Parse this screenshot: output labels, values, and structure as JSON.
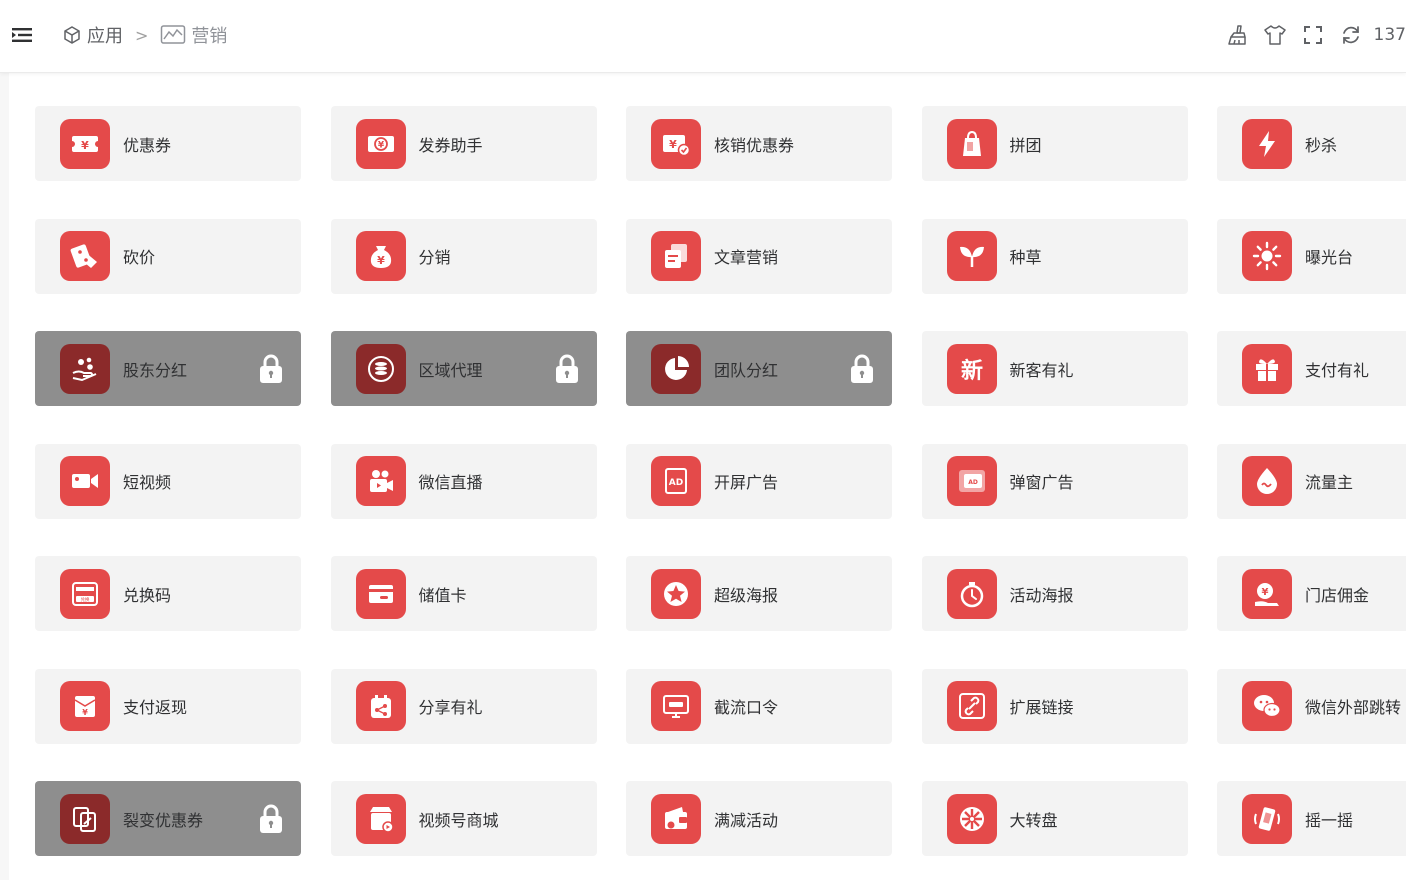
{
  "header": {
    "breadcrumb": [
      {
        "label": "应用",
        "icon": "cube-icon"
      },
      {
        "label": "营销",
        "icon": "marketing-chart-icon"
      }
    ],
    "separator": ">",
    "actions": [
      "broom-icon",
      "tshirt-icon",
      "fullscreen-icon",
      "refresh-icon"
    ],
    "user_id": "137"
  },
  "colors": {
    "accent": "#e44a4a",
    "card_bg": "#f3f3f3",
    "locked_card_bg": "#8e8e8e",
    "locked_icon_bg": "#8b2a2a"
  },
  "apps": [
    {
      "label": "优惠券",
      "icon": "coupon-icon",
      "locked": false
    },
    {
      "label": "发券助手",
      "icon": "coupon-send-icon",
      "locked": false
    },
    {
      "label": "核销优惠券",
      "icon": "coupon-verify-icon",
      "locked": false
    },
    {
      "label": "拼团",
      "icon": "group-buy-icon",
      "locked": false
    },
    {
      "label": "秒杀",
      "icon": "flash-sale-icon",
      "locked": false
    },
    {
      "label": "砍价",
      "icon": "bargain-icon",
      "locked": false
    },
    {
      "label": "分销",
      "icon": "distribution-icon",
      "locked": false
    },
    {
      "label": "文章营销",
      "icon": "article-icon",
      "locked": false
    },
    {
      "label": "种草",
      "icon": "sprout-icon",
      "locked": false
    },
    {
      "label": "曝光台",
      "icon": "sun-icon",
      "locked": false
    },
    {
      "label": "股东分红",
      "icon": "shareholder-icon",
      "locked": true
    },
    {
      "label": "区域代理",
      "icon": "region-agent-icon",
      "locked": true
    },
    {
      "label": "团队分红",
      "icon": "pie-chart-icon",
      "locked": true
    },
    {
      "label": "新客有礼",
      "icon": "new-customer-icon",
      "locked": false
    },
    {
      "label": "支付有礼",
      "icon": "gift-icon",
      "locked": false
    },
    {
      "label": "短视频",
      "icon": "video-camera-icon",
      "locked": false
    },
    {
      "label": "微信直播",
      "icon": "live-stream-icon",
      "locked": false
    },
    {
      "label": "开屏广告",
      "icon": "splash-ad-icon",
      "locked": false
    },
    {
      "label": "弹窗广告",
      "icon": "popup-ad-icon",
      "locked": false
    },
    {
      "label": "流量主",
      "icon": "traffic-drop-icon",
      "locked": false
    },
    {
      "label": "兑换码",
      "icon": "redeem-code-icon",
      "locked": false
    },
    {
      "label": "储值卡",
      "icon": "stored-value-card-icon",
      "locked": false
    },
    {
      "label": "超级海报",
      "icon": "star-poster-icon",
      "locked": false
    },
    {
      "label": "活动海报",
      "icon": "stopwatch-icon",
      "locked": false
    },
    {
      "label": "门店佣金",
      "icon": "store-commission-icon",
      "locked": false
    },
    {
      "label": "支付返现",
      "icon": "cashback-envelope-icon",
      "locked": false
    },
    {
      "label": "分享有礼",
      "icon": "share-gift-icon",
      "locked": false
    },
    {
      "label": "截流口令",
      "icon": "password-screen-icon",
      "locked": false
    },
    {
      "label": "扩展链接",
      "icon": "link-icon",
      "locked": false
    },
    {
      "label": "微信外部跳转",
      "icon": "wechat-icon",
      "locked": false
    },
    {
      "label": "裂变优惠券",
      "icon": "fission-coupon-icon",
      "locked": true
    },
    {
      "label": "视频号商城",
      "icon": "video-mall-icon",
      "locked": false
    },
    {
      "label": "满减活动",
      "icon": "discount-wallet-icon",
      "locked": false
    },
    {
      "label": "大转盘",
      "icon": "wheel-icon",
      "locked": false
    },
    {
      "label": "摇一摇",
      "icon": "shake-phone-icon",
      "locked": false
    }
  ]
}
